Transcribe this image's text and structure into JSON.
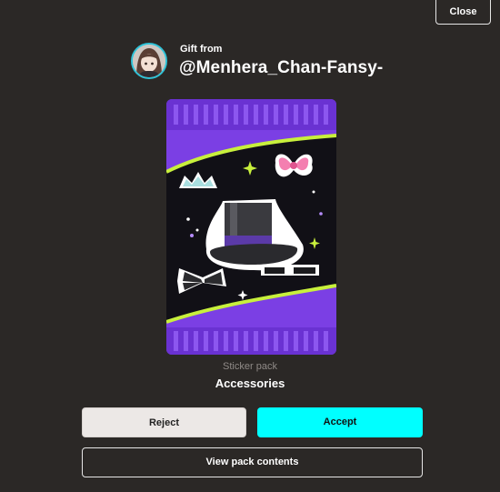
{
  "header": {
    "close_label": "Close"
  },
  "gift": {
    "from_label": "Gift from",
    "sender": "@Menhera_Chan-Fansy-"
  },
  "pack": {
    "type_label": "Sticker pack",
    "name": "Accessories"
  },
  "actions": {
    "reject_label": "Reject",
    "accept_label": "Accept",
    "view_label": "View pack contents"
  },
  "colors": {
    "background": "#2b2826",
    "accent": "#00ffff",
    "pack_purple": "#7a3fe6",
    "pack_lime": "#c8f03c",
    "avatar_ring": "#2fc3d8"
  }
}
